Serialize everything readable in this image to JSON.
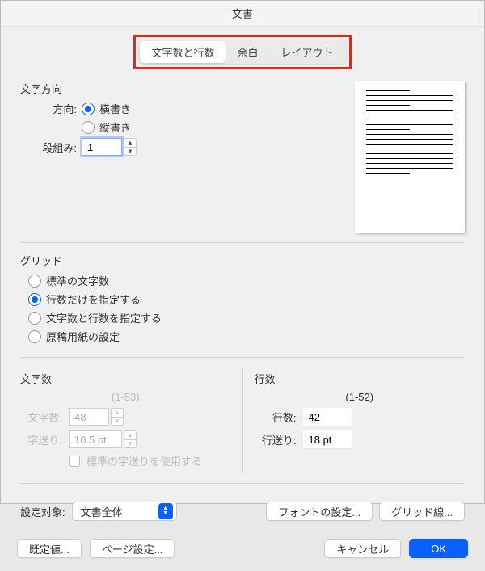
{
  "title": "文書",
  "tabs": {
    "grid": "文字数と行数",
    "margins": "余白",
    "layout": "レイアウト"
  },
  "direction": {
    "heading": "文字方向",
    "label": "方向:",
    "horizontal": "横書き",
    "vertical": "縦書き",
    "columns_label": "段組み:",
    "columns_value": "1"
  },
  "grid": {
    "heading": "グリッド",
    "opt_standard": "標準の文字数",
    "opt_lines_only": "行数だけを指定する",
    "opt_chars_and_lines": "文字数と行数を指定する",
    "opt_genko": "原稿用紙の設定"
  },
  "chars": {
    "heading": "文字数",
    "range": "(1-53)",
    "count_label": "文字数:",
    "count_value": "48",
    "pitch_label": "字送り:",
    "pitch_value": "10.5 pt",
    "use_default": "標準の字送りを使用する"
  },
  "lines": {
    "heading": "行数",
    "range": "(1-52)",
    "count_label": "行数:",
    "count_value": "42",
    "pitch_label": "行送り:",
    "pitch_value": "18 pt"
  },
  "apply": {
    "label": "設定対象:",
    "value": "文書全体",
    "font_btn": "フォントの設定...",
    "gridlines_btn": "グリッド線..."
  },
  "footer": {
    "defaults": "既定値...",
    "page_setup": "ページ設定...",
    "cancel": "キャンセル",
    "ok": "OK"
  }
}
